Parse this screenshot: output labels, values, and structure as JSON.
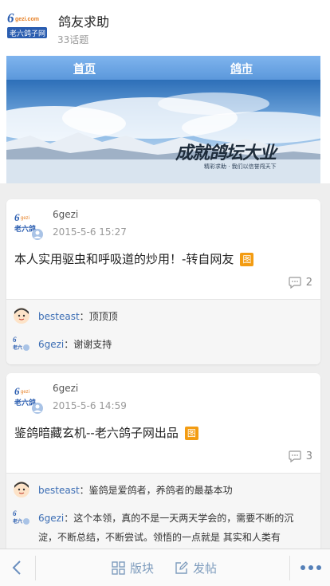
{
  "header": {
    "title": "鸽友求助",
    "topic_count": "33话题",
    "logo_text": "6gezi.com 老六鸽子网"
  },
  "banner": {
    "nav_home": "首页",
    "nav_market": "鸽市",
    "slogan": "成就鸽坛大业",
    "sub_slogan": "精彩求助 · 我们以信誉闯天下"
  },
  "posts": [
    {
      "author": "6gezi",
      "time": "2015-5-6 15:27",
      "title": "本人实用驱虫和呼吸道的炒用！-转自网友",
      "img_tag": "图",
      "comment_count": "2",
      "replies": [
        {
          "user": "besteast",
          "text": "：顶顶顶"
        },
        {
          "user": "6gezi",
          "text": "：谢谢支持"
        }
      ]
    },
    {
      "author": "6gezi",
      "time": "2015-5-6 14:59",
      "title": "鉴鸽暗藏玄机--老六鸽子网出品",
      "img_tag": "图",
      "comment_count": "3",
      "replies": [
        {
          "user": "besteast",
          "text": "：鉴鸽是爱鸽者，养鸽者的最基本功"
        },
        {
          "user": "6gezi",
          "text": "：这个本领，真的不是一天两天学会的，需要不断的沉淀，不断总结，不断尝试。领悟的一点就是 其实和人类有"
        }
      ]
    }
  ],
  "bottom_bar": {
    "forum_label": "版块",
    "post_label": "发帖"
  },
  "icons": [
    "logo-icon",
    "avatar-icon",
    "comment-icon",
    "back-icon",
    "grid-icon",
    "edit-icon",
    "more-icon"
  ],
  "colors": {
    "link_blue": "#3b6db4",
    "tag_orange": "#f39c12",
    "nav_blue": "#5b98db"
  }
}
